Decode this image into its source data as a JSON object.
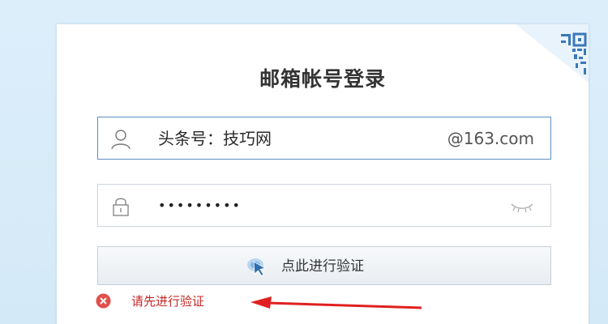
{
  "login": {
    "title": "邮箱帐号登录",
    "account": {
      "value": "头条号：技巧网",
      "domain_suffix": "@163.com"
    },
    "password": {
      "masked_value": "•••••••••"
    },
    "verify_button": {
      "label": "点此进行验证"
    },
    "error": {
      "message": "请先进行验证"
    }
  },
  "colors": {
    "background": "#d9ecf8",
    "active_border": "#5d8fc4",
    "error_text": "#c62828",
    "arrow": "#e02020"
  },
  "icons": {
    "qr_corner": "qr-code-icon",
    "account": "user-icon",
    "password": "lock-icon",
    "show_password": "eye-closed-icon",
    "verify": "cursor-click-icon",
    "error": "error-circle-icon"
  }
}
